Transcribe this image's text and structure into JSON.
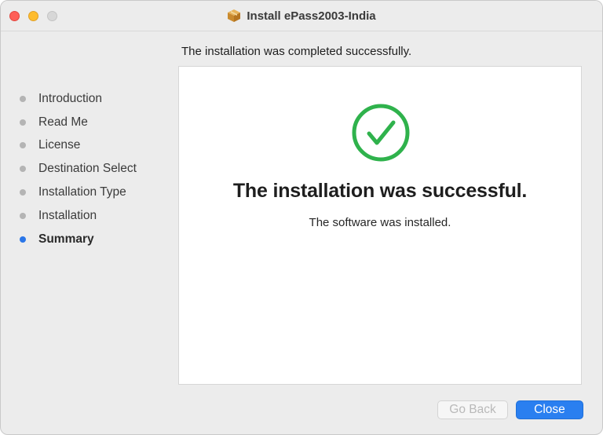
{
  "window": {
    "title": "Install ePass2003-India",
    "controls": [
      "close",
      "minimize",
      "zoom"
    ]
  },
  "header": {
    "status": "The installation was completed successfully."
  },
  "sidebar": {
    "steps": [
      {
        "label": "Introduction",
        "state": "done"
      },
      {
        "label": "Read Me",
        "state": "done"
      },
      {
        "label": "License",
        "state": "done"
      },
      {
        "label": "Destination Select",
        "state": "done"
      },
      {
        "label": "Installation Type",
        "state": "done"
      },
      {
        "label": "Installation",
        "state": "done"
      },
      {
        "label": "Summary",
        "state": "current"
      }
    ]
  },
  "main": {
    "icon": "success-checkmark-icon",
    "title": "The installation was successful.",
    "subtitle": "The software was installed."
  },
  "buttons": {
    "back_label": "Go Back",
    "close_label": "Close"
  },
  "colors": {
    "success": "#2fb24c",
    "accent": "#2a7ff0",
    "step_inactive": "#b4b4b4"
  }
}
